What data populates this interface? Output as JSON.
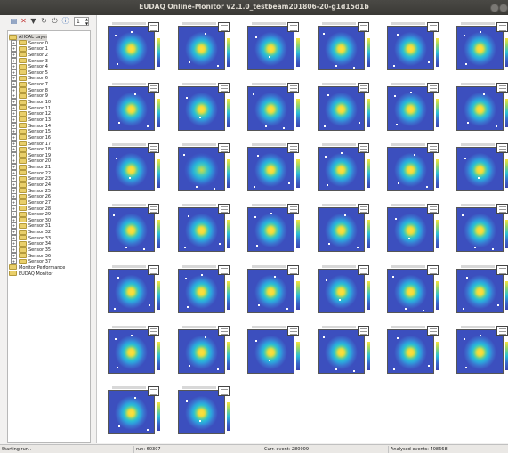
{
  "window": {
    "title": "EUDAQ Online-Monitor v2.1.0_testbeam201806-20-g1d15d1b"
  },
  "toolbar": {
    "icons": [
      "save-icon",
      "clear-icon",
      "filter-icon",
      "refresh-icon",
      "power-icon",
      "info-icon"
    ],
    "spin_value": "1"
  },
  "tree": {
    "root": "AHCAL Layer",
    "sensors": [
      "Sensor 0",
      "Sensor 1",
      "Sensor 2",
      "Sensor 3",
      "Sensor 4",
      "Sensor 5",
      "Sensor 6",
      "Sensor 7",
      "Sensor 8",
      "Sensor 9",
      "Sensor 10",
      "Sensor 11",
      "Sensor 12",
      "Sensor 13",
      "Sensor 14",
      "Sensor 15",
      "Sensor 16",
      "Sensor 17",
      "Sensor 18",
      "Sensor 19",
      "Sensor 20",
      "Sensor 21",
      "Sensor 22",
      "Sensor 23",
      "Sensor 24",
      "Sensor 25",
      "Sensor 26",
      "Sensor 27",
      "Sensor 28",
      "Sensor 29",
      "Sensor 30",
      "Sensor 31",
      "Sensor 32",
      "Sensor 33",
      "Sensor 34",
      "Sensor 35",
      "Sensor 36",
      "Sensor 37"
    ],
    "extra": [
      "Monitor Performance",
      "EUDAQ Monitor"
    ]
  },
  "plots": {
    "count": 38,
    "colors": {
      "peak": "#fae43c",
      "mid": "#2cc0d0",
      "low": "#3c4fbe"
    }
  },
  "status": {
    "message": "Starting run..",
    "run": "run: 60307",
    "current_event": "Curr. event: 280009",
    "analysed": "Analysed events: 408668"
  }
}
